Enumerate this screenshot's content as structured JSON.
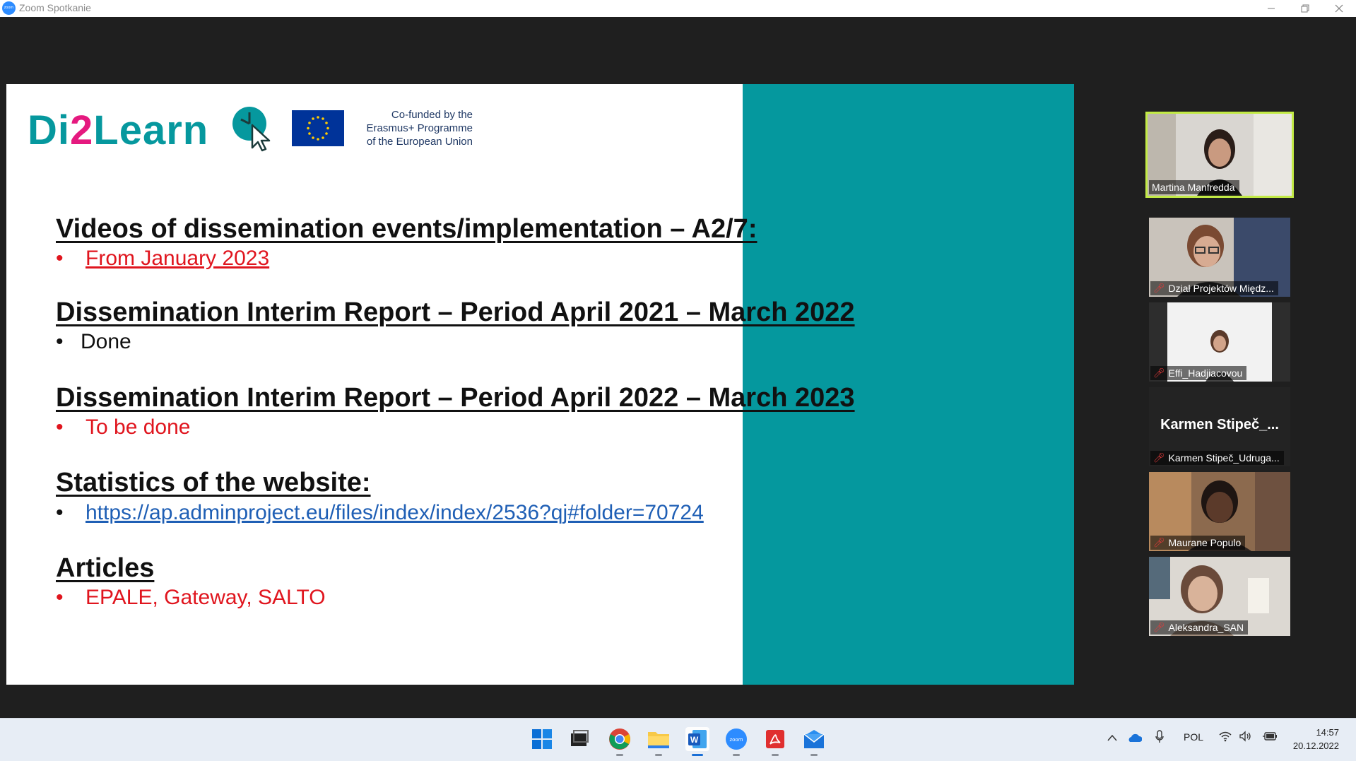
{
  "window": {
    "app_icon_text": "zoom",
    "title": "Zoom Spotkanie",
    "controls": [
      "minimize",
      "restore",
      "close"
    ]
  },
  "slide": {
    "logo": {
      "prefix": "Di",
      "two": "2",
      "suffix": "Learn"
    },
    "eu_text": [
      "Co-funded by the",
      "Erasmus+ Programme",
      "of the European Union"
    ],
    "sections": [
      {
        "heading": "Videos of dissemination events/implementation – A2/7:",
        "bullet": "From January 2023",
        "style": "red-link"
      },
      {
        "heading": "Dissemination Interim Report – Period April 2021 – March 2022",
        "bullet": "Done",
        "style": "black"
      },
      {
        "heading": "Dissemination Interim Report – Period April 2022 – March 2023",
        "bullet": "To be done",
        "style": "red"
      },
      {
        "heading": "Statistics of the website:",
        "bullet": "https://ap.adminproject.eu/files/index/index/2536?qj#folder=70724",
        "style": "blue-link"
      },
      {
        "heading": "Articles",
        "bullet": "EPALE, Gateway, SALTO",
        "style": "red"
      }
    ],
    "bullet_char": "•",
    "colors": {
      "teal": "#05989e",
      "red": "#e0151e",
      "link_blue": "#1f5fb5",
      "logo_pink": "#e5197f"
    }
  },
  "participants": [
    {
      "name": "Martina Manfredda",
      "muted": false,
      "active": true,
      "video": true
    },
    {
      "name": "Dział Projektów Międz...",
      "muted": true,
      "active": false,
      "video": true
    },
    {
      "name": "Effi_Hadjiacovou",
      "muted": true,
      "active": false,
      "video": true
    },
    {
      "name": "Karmen Stipeč_Udruga...",
      "display_name": "Karmen  Stipeč_...",
      "muted": true,
      "active": false,
      "video": false
    },
    {
      "name": "Maurane Populo",
      "muted": true,
      "active": false,
      "video": true
    },
    {
      "name": "Aleksandra_SAN",
      "muted": true,
      "active": false,
      "video": true
    }
  ],
  "taskbar": {
    "apps": [
      "start",
      "task-view",
      "chrome",
      "file-explorer",
      "word",
      "zoom",
      "acrobat",
      "mail"
    ],
    "tray": {
      "language": "POL",
      "time": "14:57",
      "date": "20.12.2022"
    }
  }
}
